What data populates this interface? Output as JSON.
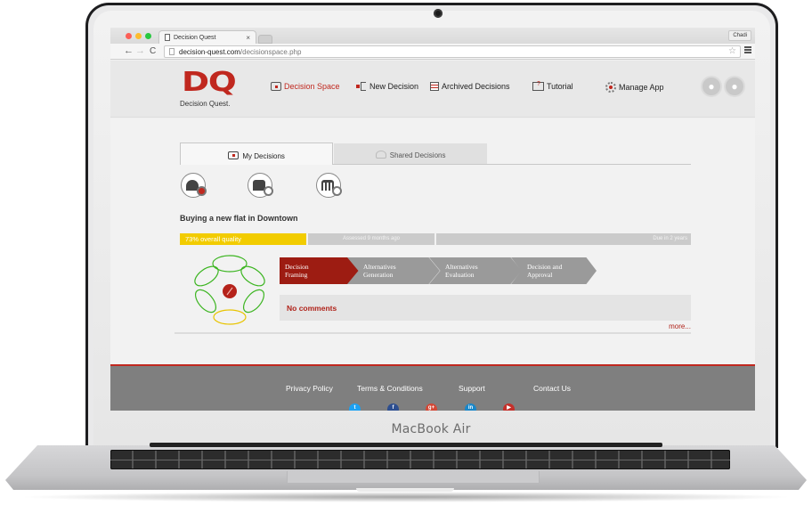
{
  "device": {
    "label": "MacBook Air"
  },
  "browser": {
    "tab_title": "Decision Quest",
    "tab_close": "×",
    "user_chip": "Chadi",
    "url_domain": "decision-quest.com",
    "url_path": "/decisionspace.php",
    "back": "←",
    "forward": "→",
    "reload": "C",
    "bookmark_star": "☆"
  },
  "header": {
    "logo_mark": "DQ",
    "logo_text": "Decision Quest.",
    "nav": [
      {
        "label": "Decision Space",
        "icon": "decision-space-icon",
        "active": true
      },
      {
        "label": "New Decision",
        "icon": "new-decision-icon"
      },
      {
        "label": "Archived Decisions",
        "icon": "archive-icon"
      },
      {
        "label": "Tutorial",
        "icon": "tutorial-icon"
      },
      {
        "label": "Manage App",
        "icon": "gear-icon"
      }
    ],
    "notifications_icon": "bell-icon",
    "profile_icon": "user-icon"
  },
  "tabs": [
    {
      "label": "My Decisions",
      "active": true
    },
    {
      "label": "Shared Decisions",
      "active": false
    }
  ],
  "stakeholders": [
    {
      "icon": "person-icon",
      "selected": true
    },
    {
      "icon": "briefcase-icon",
      "selected": false
    },
    {
      "icon": "bank-icon",
      "selected": false
    }
  ],
  "decision": {
    "title": "Buying a new flat in Downtown",
    "quality_percent": 73,
    "quality_label": "73% overall quality",
    "assessed": "Assessed 9 months ago",
    "due": "Due in 2 years",
    "steps": [
      {
        "label_line1": "Decision",
        "label_line2": "Framing",
        "active": true
      },
      {
        "label_line1": "Alternatives",
        "label_line2": "Generation",
        "active": false
      },
      {
        "label_line1": "Alternatives",
        "label_line2": "Evaluation",
        "active": false
      },
      {
        "label_line1": "Decision and",
        "label_line2": "Approval",
        "active": false
      }
    ],
    "comments": "No comments",
    "more_link": "more..."
  },
  "footer": {
    "links": [
      "Privacy Policy",
      "Terms & Conditions",
      "Support",
      "Contact Us"
    ],
    "social": [
      {
        "name": "twitter",
        "glyph": "t",
        "color": "#1da1f2"
      },
      {
        "name": "facebook",
        "glyph": "f",
        "color": "#2d4e8f"
      },
      {
        "name": "google-plus",
        "glyph": "g+",
        "color": "#d34836"
      },
      {
        "name": "linkedin",
        "glyph": "in",
        "color": "#1a87c9"
      },
      {
        "name": "youtube",
        "glyph": "▶",
        "color": "#c4302b"
      }
    ]
  },
  "colors": {
    "brand_red": "#c0281f",
    "quality_yellow": "#f2cc00",
    "step_active": "#9d1c12",
    "step_inactive": "#9a9a9a",
    "footer_gray": "#7f7f7f"
  }
}
